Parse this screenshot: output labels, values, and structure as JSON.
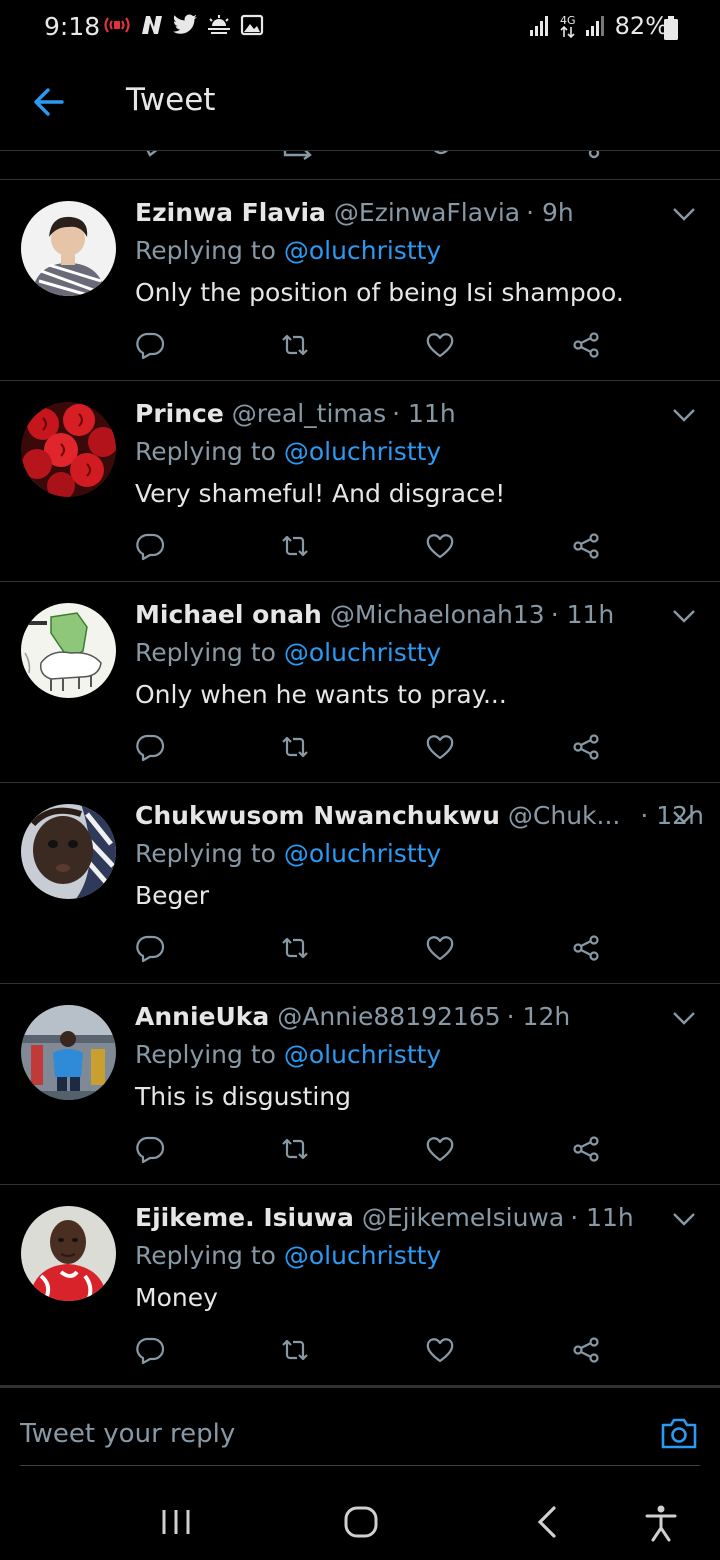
{
  "status_bar": {
    "time": "9:18",
    "battery": "82%",
    "network_label": "4G"
  },
  "header": {
    "title": "Tweet"
  },
  "tweets": [
    {
      "name": "Ezinwa Flavia",
      "handle": "@EzinwaFlavia",
      "time": "· 9h",
      "replying_prefix": "Replying to ",
      "replying_to": "@oluchristty",
      "text": "Only the position of being Isi shampoo."
    },
    {
      "name": "Prince",
      "handle": "@real_timas",
      "time": "· 11h",
      "replying_prefix": "Replying to ",
      "replying_to": "@oluchristty",
      "text": "Very shameful!  And disgrace!"
    },
    {
      "name": "Michael onah",
      "handle": "@Michaelonah13",
      "time": "· 11h",
      "replying_prefix": "Replying to ",
      "replying_to": "@oluchristty",
      "text": "Only when he wants to pray..."
    },
    {
      "name": "Chukwusom Nwanchukwu",
      "handle": "@Chuk...",
      "time": "· 12h",
      "replying_prefix": "Replying to ",
      "replying_to": "@oluchristty",
      "text": "Beger"
    },
    {
      "name": "AnnieUka",
      "handle": "@Annie88192165",
      "time": "· 12h",
      "replying_prefix": "Replying to ",
      "replying_to": "@oluchristty",
      "text": "This is disgusting"
    },
    {
      "name": "Ejikeme. Isiuwa",
      "handle": "@EjikemeIsiuwa",
      "time": "· 11h",
      "replying_prefix": "Replying to ",
      "replying_to": "@oluchristty",
      "text": "Money"
    }
  ],
  "reply_bar": {
    "placeholder": "Tweet your reply"
  },
  "colors": {
    "background": "#000000",
    "accent": "#2b9af3",
    "muted": "#8899a6",
    "divider": "#2f3336"
  }
}
